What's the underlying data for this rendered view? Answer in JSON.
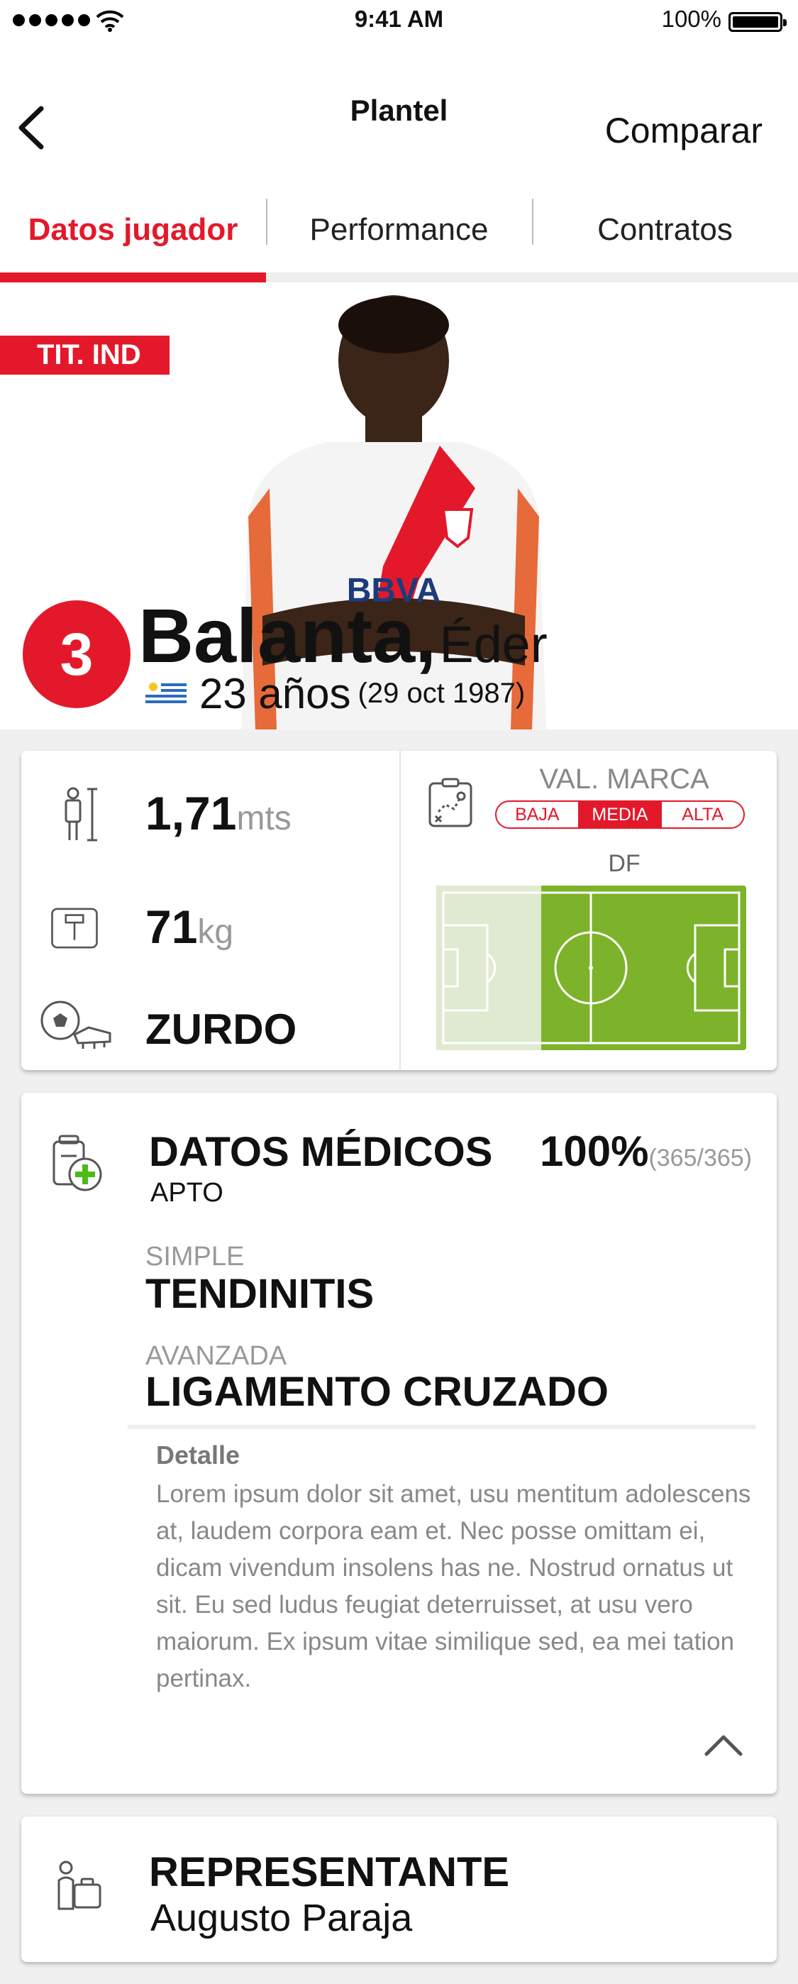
{
  "status_bar": {
    "time": "9:41 AM",
    "battery": "100%"
  },
  "nav": {
    "title": "Plantel",
    "compare": "Comparar"
  },
  "tabs": [
    {
      "label": "Datos jugador",
      "active": true
    },
    {
      "label": "Performance",
      "active": false
    },
    {
      "label": "Contratos",
      "active": false
    }
  ],
  "player": {
    "badge": "TIT. IND",
    "number": "3",
    "last_name": "Balanta,",
    "first_name": "Éder",
    "age": "23 años",
    "dob": "(29 oct 1987)",
    "flag": "uruguay-flag"
  },
  "stats": {
    "height_value": "1,71",
    "height_unit": "mts",
    "weight_value": "71",
    "weight_unit": "kg",
    "foot": "ZURDO",
    "market_label": "VAL. MARCA",
    "market_options": [
      "BAJA",
      "MEDIA",
      "ALTA"
    ],
    "market_selected": "MEDIA",
    "position": "DF"
  },
  "medical": {
    "title": "DATOS MÉDICOS",
    "status": "APTO",
    "percent": "100%",
    "days": "(365/365)",
    "injuries": [
      {
        "level": "SIMPLE",
        "name": "TENDINITIS"
      },
      {
        "level": "AVANZADA",
        "name": "LIGAMENTO CRUZADO"
      }
    ],
    "detail_label": "Detalle",
    "detail_text": "Lorem ipsum dolor sit amet, usu mentitum adolescens at, laudem corpora eam et. Nec posse omittam ei, dicam vivendum insolens has ne. Nostrud ornatus ut sit. Eu sed ludus feugiat deterruisset, at usu vero maiorum. Ex ipsum vitae similique sed, ea mei tation pertinax."
  },
  "agent": {
    "title": "REPRESENTANTE",
    "name": "Augusto Paraja"
  },
  "colors": {
    "accent": "#e3192b",
    "pitch": "#7cb32a",
    "pitch_light": "#dfead0"
  }
}
